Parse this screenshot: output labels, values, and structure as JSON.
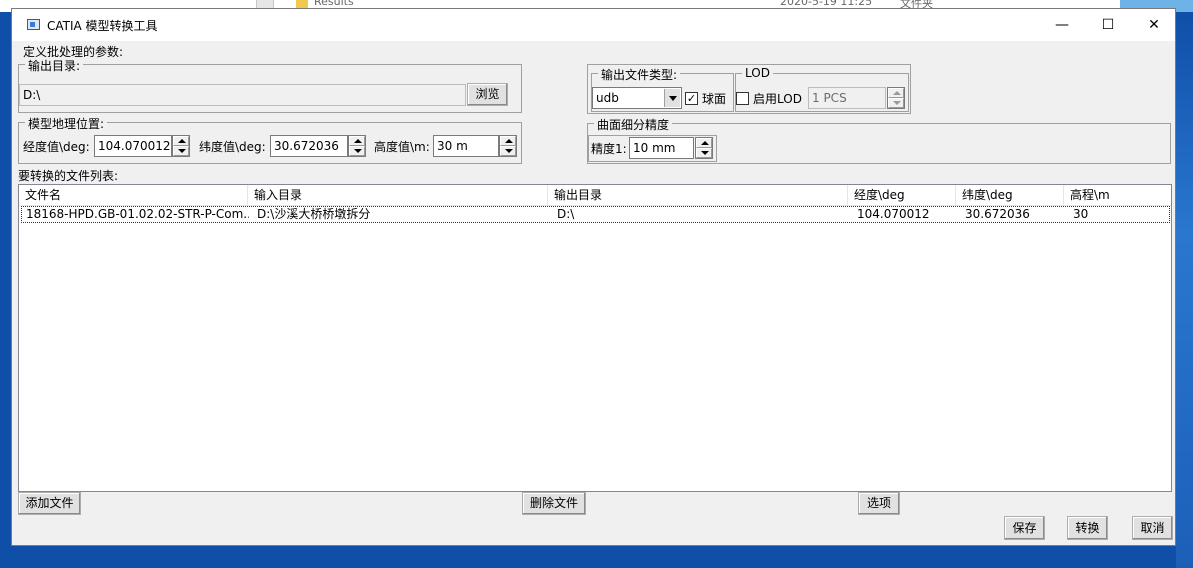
{
  "background": {
    "folder_name": "Results",
    "folder_date": "2020-5-19 11:25",
    "folder_type": "文件夹"
  },
  "window": {
    "title": "CATIA 模型转换工具",
    "minimize": "—",
    "maximize": "☐",
    "close": "✕"
  },
  "params_label": "定义批处理的参数:",
  "output_dir": {
    "group_title": "输出目录:",
    "value": "D:\\",
    "browse_label": "浏览"
  },
  "geo": {
    "group_title": "模型地理位置:",
    "lon_label": "经度值\\deg:",
    "lon_value": "104.070012",
    "lat_label": "纬度值\\deg:",
    "lat_value": "30.672036",
    "alt_label": "高度值\\m:",
    "alt_value": "30 m"
  },
  "output_type": {
    "group_title": "输出文件类型:",
    "selected": "udb",
    "sphere_label": "球面",
    "sphere_checked": true
  },
  "lod": {
    "group_title": "LOD",
    "enable_label": "启用LOD",
    "enabled": false,
    "value": "1 PCS"
  },
  "precision": {
    "group_title": "曲面细分精度",
    "label": "精度1:",
    "value": "10 mm"
  },
  "file_list": {
    "label": "要转换的文件列表:",
    "columns": [
      "文件名",
      "输入目录",
      "输出目录",
      "经度\\deg",
      "纬度\\deg",
      "高程\\m"
    ],
    "rows": [
      [
        "18168-HPD.GB-01.02.02-STR-P-Com...",
        "D:\\沙溪大桥桥墩拆分",
        "D:\\",
        "104.070012",
        "30.672036",
        "30"
      ]
    ]
  },
  "buttons": {
    "add_file": "添加文件",
    "delete_file": "删除文件",
    "options": "选项",
    "save": "保存",
    "convert": "转换",
    "cancel": "取消"
  }
}
